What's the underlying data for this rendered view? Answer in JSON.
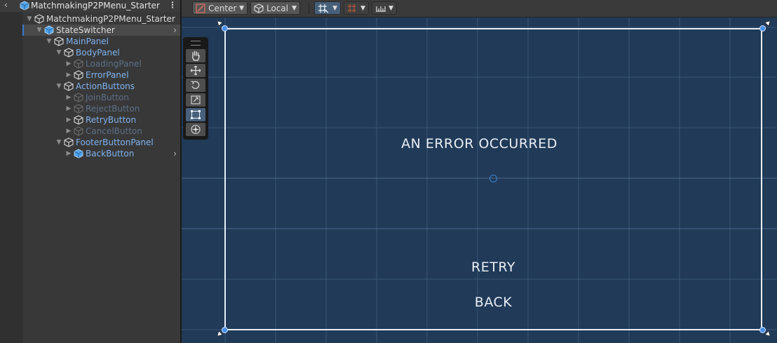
{
  "hierarchy": {
    "scene_title": "MatchmakingP2PMenu_Starter",
    "items": [
      {
        "label": "MatchmakingP2PMenu_Starter",
        "depth": 0,
        "expanded": true,
        "style": "white",
        "prefab": false
      },
      {
        "label": "StateSwitcher",
        "depth": 1,
        "expanded": true,
        "style": "white",
        "prefab": true,
        "selected": true,
        "has_chevron": true
      },
      {
        "label": "MainPanel",
        "depth": 2,
        "expanded": true,
        "style": "blue",
        "prefab": false
      },
      {
        "label": "BodyPanel",
        "depth": 3,
        "expanded": true,
        "style": "blue",
        "prefab": false
      },
      {
        "label": "LoadingPanel",
        "depth": 4,
        "expanded": false,
        "style": "dim",
        "prefab": false
      },
      {
        "label": "ErrorPanel",
        "depth": 4,
        "expanded": false,
        "style": "blue",
        "prefab": false
      },
      {
        "label": "ActionButtons",
        "depth": 3,
        "expanded": true,
        "style": "blue",
        "prefab": false
      },
      {
        "label": "JoinButton",
        "depth": 4,
        "expanded": false,
        "style": "dim",
        "prefab": false
      },
      {
        "label": "RejectButton",
        "depth": 4,
        "expanded": false,
        "style": "dim",
        "prefab": false
      },
      {
        "label": "RetryButton",
        "depth": 4,
        "expanded": false,
        "style": "blue",
        "prefab": false
      },
      {
        "label": "CancelButton",
        "depth": 4,
        "expanded": false,
        "style": "dim",
        "prefab": false
      },
      {
        "label": "FooterButtonPanel",
        "depth": 3,
        "expanded": true,
        "style": "blue",
        "prefab": false
      },
      {
        "label": "BackButton",
        "depth": 4,
        "expanded": false,
        "style": "blue",
        "prefab": true,
        "has_chevron": true
      }
    ]
  },
  "toolbar": {
    "pivot_label": "Center",
    "space_label": "Local"
  },
  "scene": {
    "error_title": "AN ERROR OCCURRED",
    "retry_label": "RETRY",
    "back_label": "BACK"
  },
  "colors": {
    "scene_background": "#203a58",
    "hierarchy_background": "#383838",
    "selection_accent": "#3a7ad0",
    "active_label": "#7fb3ef",
    "inactive_label": "#5c6f88"
  }
}
